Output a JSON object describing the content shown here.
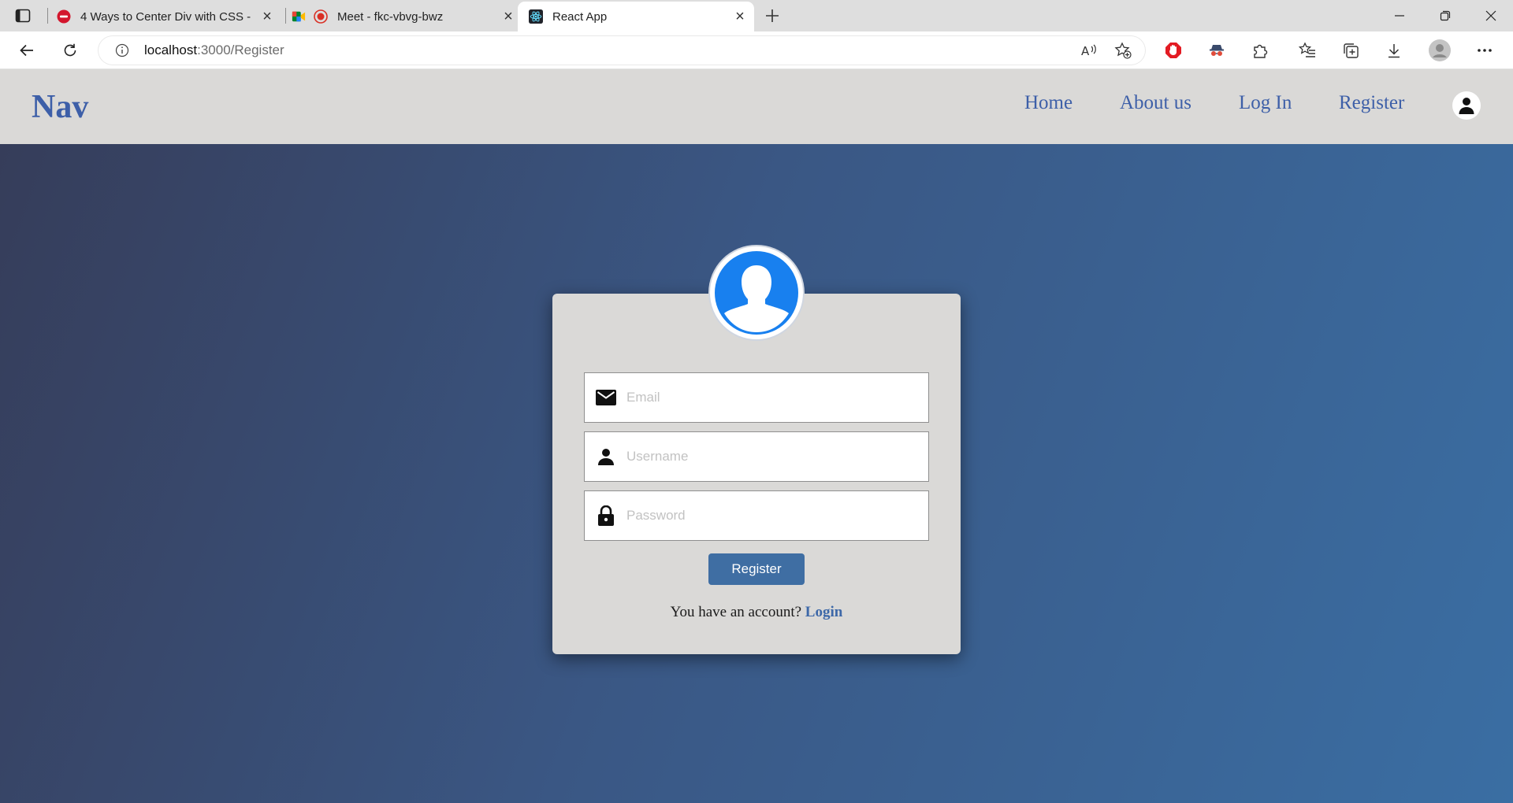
{
  "browser": {
    "tabs": [
      {
        "title": "4 Ways to Center Div with CSS - I",
        "favicon": "no-entry-icon",
        "active": false
      },
      {
        "title": "Meet - fkc-vbvg-bwz",
        "favicon": "meet-icon",
        "active": false
      },
      {
        "title": "React App",
        "favicon": "react-icon",
        "active": true
      }
    ],
    "address": {
      "host": "localhost",
      "path": ":3000/Register"
    }
  },
  "nav": {
    "brand": "Nav",
    "links": [
      "Home",
      "About us",
      "Log In",
      "Register"
    ]
  },
  "form": {
    "email_placeholder": "Email",
    "username_placeholder": "Username",
    "password_placeholder": "Password",
    "submit_label": "Register",
    "switch_text": "You have an account?",
    "switch_link": "Login"
  },
  "colors": {
    "brand": "#3d5fa8",
    "navbar_bg": "#dad9d7",
    "button": "#3f6ea3",
    "avatar": "#1880ef",
    "gradient_start": "#363d5a",
    "gradient_end": "#3a6ea3"
  }
}
